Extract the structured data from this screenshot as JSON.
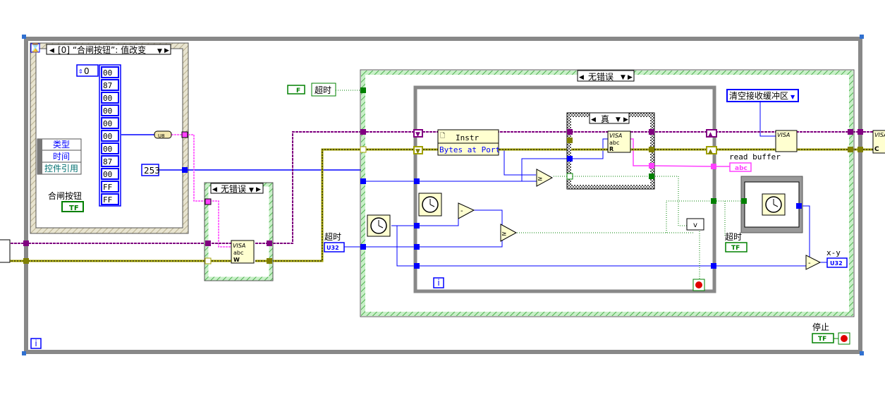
{
  "event_structure": {
    "selector": "[0] “合闸按钮”: 值改变",
    "event_data": [
      "类型",
      "时间",
      "控件引用"
    ],
    "array_index": "0",
    "array_values": [
      "00",
      "87",
      "00",
      "00",
      "00",
      "00",
      "00",
      "87",
      "00",
      "FF",
      "FF"
    ],
    "to_u8_label": "U8",
    "button_label": "合闸按钮",
    "button_terminal": "TF"
  },
  "constants": {
    "byte_count": "253",
    "timeout_bool_const": "F",
    "timeout_bool_label": "超时",
    "timeout_u32_label": "超时",
    "timeout_u32_type": "U32"
  },
  "left_case": {
    "selector": "无错误",
    "visa_write": "VISA",
    "visa_sub": "abc",
    "visa_mode": "W"
  },
  "main_case": {
    "selector": "无错误"
  },
  "inner_loop": {
    "property_node_class": "Instr",
    "property_node_item": "Bytes at Port",
    "true_case_selector": "真",
    "visa_read": "VISA",
    "visa_read_sub": "abc",
    "visa_read_mode": "R",
    "or_label": "v",
    "iteration": "i"
  },
  "flush": {
    "mask": "清空接收缓冲区",
    "visa_flush": "VISA"
  },
  "indicators": {
    "read_buffer_label": "read buffer",
    "read_buffer_type": "abc",
    "timeout_label": "超时",
    "timeout_type": "TF",
    "xy_label": "x-y",
    "xy_type": "U32"
  },
  "outer_loop": {
    "iteration": "i",
    "stop_label": "停止",
    "stop_type": "TF",
    "visa_close": "VISA",
    "visa_close_sub": "C"
  },
  "colors": {
    "refnum_wire": "#800080",
    "error_wire": "#a0a000",
    "integer_wire": "#0000ff",
    "string_wire": "#ff40ff",
    "boolean_wire": "#008000",
    "loop_frame": "#888888",
    "case_frame": "#a0e0a0"
  }
}
